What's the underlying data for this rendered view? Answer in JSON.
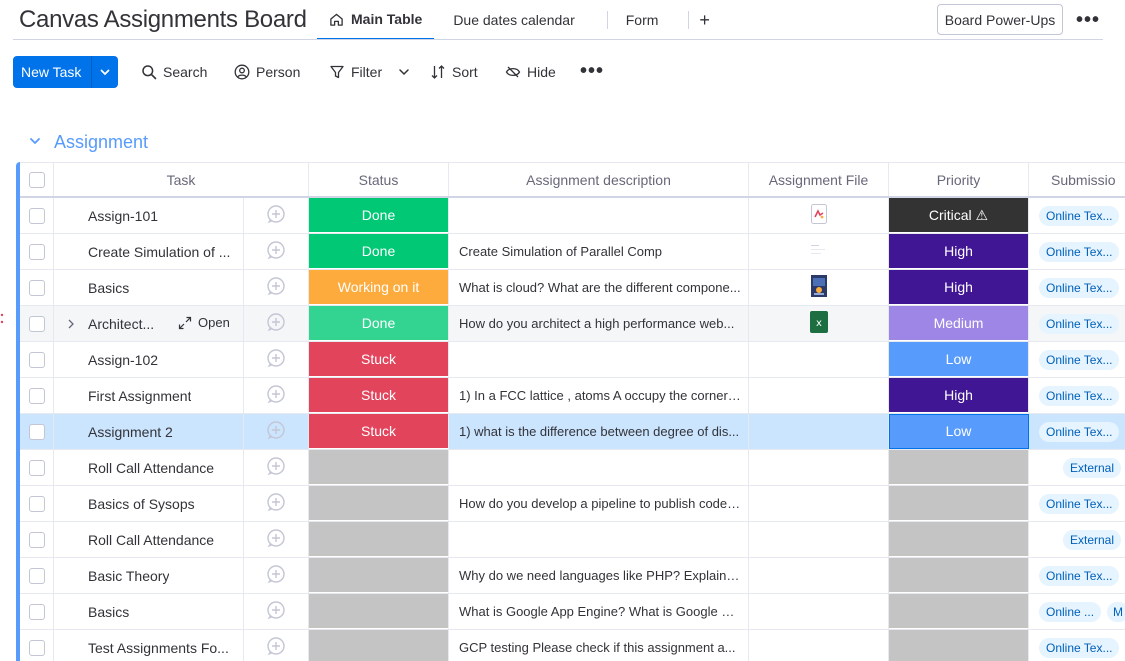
{
  "board": {
    "title": "Canvas Assignments Board"
  },
  "views": [
    {
      "label": "Main Table",
      "active": true
    },
    {
      "label": "Due dates calendar",
      "active": false
    },
    {
      "label": "Form",
      "active": false
    }
  ],
  "header": {
    "add_view": "+",
    "powerups_label": "Board Power-Ups",
    "more": "•••"
  },
  "toolbar": {
    "new_task_label": "New Task",
    "search_label": "Search",
    "person_label": "Person",
    "filter_label": "Filter",
    "sort_label": "Sort",
    "hide_label": "Hide",
    "more": "•••"
  },
  "group": {
    "title": "Assignment"
  },
  "columns": {
    "task": "Task",
    "status": "Status",
    "description": "Assignment description",
    "file": "Assignment File",
    "priority": "Priority",
    "submission": "Submissio"
  },
  "colors": {
    "accent": "#0073ea",
    "group": "#579bfc",
    "done": "#00c875",
    "done_hover": "#33d391",
    "working": "#fdab3d",
    "stuck": "#e2445c",
    "empty": "#c4c4c4",
    "critical": "#333333",
    "high": "#401694",
    "medium": "#9d86e5",
    "low": "#579bfc"
  },
  "open_label": "Open",
  "rows": [
    {
      "task": "Assign-101",
      "status": "Done",
      "status_key": "done",
      "desc": "",
      "file": "pdf-file-icon",
      "priority": "Critical ⚠",
      "priority_key": "critical",
      "sub": "Online Tex...",
      "sub2": ""
    },
    {
      "task": "Create Simulation of ...",
      "status": "Done",
      "status_key": "done",
      "desc": "Create Simulation of Parallel Comp",
      "file": "doc-thumbnail-icon",
      "priority": "High",
      "priority_key": "high",
      "sub": "Online Tex...",
      "sub2": ""
    },
    {
      "task": "Basics",
      "status": "Working on it",
      "status_key": "working",
      "desc": "What is cloud? What are the different compone...",
      "file": "image-thumbnail-icon",
      "priority": "High",
      "priority_key": "high",
      "sub": "Online Tex...",
      "sub2": ""
    },
    {
      "task": "Architect...",
      "status": "Done",
      "status_key": "done_hover",
      "desc": "How do you architect a high performance web...",
      "file": "excel-file-icon",
      "priority": "Medium",
      "priority_key": "medium",
      "sub": "Online Tex...",
      "sub2": "",
      "hover": true
    },
    {
      "task": "Assign-102",
      "status": "Stuck",
      "status_key": "stuck",
      "desc": "",
      "file": "",
      "priority": "Low",
      "priority_key": "low",
      "sub": "Online Tex...",
      "sub2": ""
    },
    {
      "task": "First Assignment",
      "status": "Stuck",
      "status_key": "stuck",
      "desc": "1) In a FCC lattice , atoms A occupy the corner ...",
      "file": "",
      "priority": "High",
      "priority_key": "high",
      "sub": "Online Tex...",
      "sub2": ""
    },
    {
      "task": "Assignment 2",
      "status": "Stuck",
      "status_key": "stuck",
      "desc": "1) what is the difference between degree of dis...",
      "file": "",
      "priority": "Low",
      "priority_key": "low",
      "sub": "Online Tex...",
      "sub2": "",
      "selected": true
    },
    {
      "task": "Roll Call Attendance",
      "status": "",
      "status_key": "empty",
      "desc": "",
      "file": "",
      "priority": "",
      "priority_key": "empty",
      "sub": "External",
      "sub2": "",
      "ext": true
    },
    {
      "task": "Basics of Sysops",
      "status": "",
      "status_key": "empty",
      "desc": "How do you develop a pipeline to publish code ...",
      "file": "",
      "priority": "",
      "priority_key": "empty",
      "sub": "Online Tex...",
      "sub2": ""
    },
    {
      "task": "Roll Call Attendance",
      "status": "",
      "status_key": "empty",
      "desc": "",
      "file": "",
      "priority": "",
      "priority_key": "empty",
      "sub": "External",
      "sub2": "",
      "ext": true
    },
    {
      "task": "Basic Theory",
      "status": "",
      "status_key": "empty",
      "desc": "Why do we need languages like PHP? Explain t...",
      "file": "",
      "priority": "",
      "priority_key": "empty",
      "sub": "Online Tex...",
      "sub2": ""
    },
    {
      "task": "Basics",
      "status": "",
      "status_key": "empty",
      "desc": "What is Google App Engine? What is Google C...",
      "file": "",
      "priority": "",
      "priority_key": "empty",
      "sub": "Online ...",
      "sub2": "M"
    },
    {
      "task": "Test Assignments Fo...",
      "status": "",
      "status_key": "empty",
      "desc": "GCP testing Please check if this assignment a...",
      "file": "",
      "priority": "",
      "priority_key": "empty",
      "sub": "Online Tex...",
      "sub2": ""
    }
  ]
}
